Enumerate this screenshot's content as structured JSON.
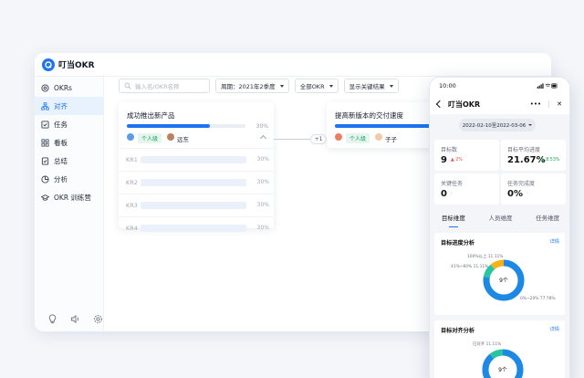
{
  "app": {
    "title": "叮当OKR"
  },
  "sidebar": {
    "items": [
      {
        "label": "OKRs",
        "icon": "target-icon",
        "active": false
      },
      {
        "label": "对齐",
        "icon": "hierarchy-icon",
        "active": true
      },
      {
        "label": "任务",
        "icon": "task-check-icon",
        "active": false
      },
      {
        "label": "看板",
        "icon": "grid-board-icon",
        "active": false
      },
      {
        "label": "总结",
        "icon": "summary-check-icon",
        "active": false
      },
      {
        "label": "分析",
        "icon": "pie-chart-icon",
        "active": false
      },
      {
        "label": "OKR 训练营",
        "icon": "graduation-cap-icon",
        "active": false
      }
    ],
    "bottom_icons": [
      "bulb-icon",
      "speaker-icon",
      "settings-icon"
    ]
  },
  "toolbar": {
    "search_placeholder": "输入名/OKR名称",
    "period_label": "周期：2021年2季度",
    "scope_label": "全部OKR",
    "display_label": "显示关键结果"
  },
  "objective_1": {
    "title": "成功推出新产品",
    "progress_percent": 70,
    "percent_text": "30%",
    "tag": "个人级",
    "owner": "远东",
    "krs": [
      {
        "label": "KR1",
        "percent_text": "30%"
      },
      {
        "label": "KR2",
        "percent_text": "30%"
      },
      {
        "label": "KR3",
        "percent_text": "30%"
      },
      {
        "label": "KR4",
        "percent_text": "30%"
      }
    ]
  },
  "link_badge": "+1",
  "objective_2": {
    "title": "提高新版本的交付速度",
    "tag": "个人级",
    "owner": "子子"
  },
  "mobile": {
    "time": "10:00",
    "nav_title": "叮当OKR",
    "more": "•••",
    "close": "✕",
    "date_range": "2022-02-10至2022-03-06",
    "stats": [
      {
        "label": "目标数",
        "value": "9",
        "delta": "▲ 2%",
        "delta_color": "#ef4444"
      },
      {
        "label": "目标平均进度",
        "value": "21.67%",
        "delta": "▲ 8.53%",
        "delta_color": "#16a34a"
      },
      {
        "label": "关键任务",
        "value": "0",
        "delta": "-",
        "delta_color": "#9ca3af"
      },
      {
        "label": "任务完成度",
        "value": "0%",
        "delta": "-",
        "delta_color": "#9ca3af"
      }
    ],
    "tabs": [
      "目标维度",
      "人员维度",
      "任务维度"
    ],
    "panel_1": {
      "title": "目标进度分析",
      "link": "详情",
      "center": "9个",
      "labels": [
        "100%以上 11.11%",
        "41%~60% 11.11%",
        "0%~20% 77.78%"
      ],
      "slices": [
        {
          "value": 77.78,
          "color": "#1e88e5"
        },
        {
          "value": 11.11,
          "color": "#26c6a3"
        },
        {
          "value": 11.11,
          "color": "#f5b316"
        }
      ]
    },
    "panel_2": {
      "title": "目标对齐分析",
      "link": "详情",
      "center": "9个",
      "labels": [
        "已对齐 11.11%"
      ],
      "slices": [
        {
          "value": 88.89,
          "color": "#1e88e5"
        },
        {
          "value": 11.11,
          "color": "#26c6a3"
        }
      ]
    }
  }
}
